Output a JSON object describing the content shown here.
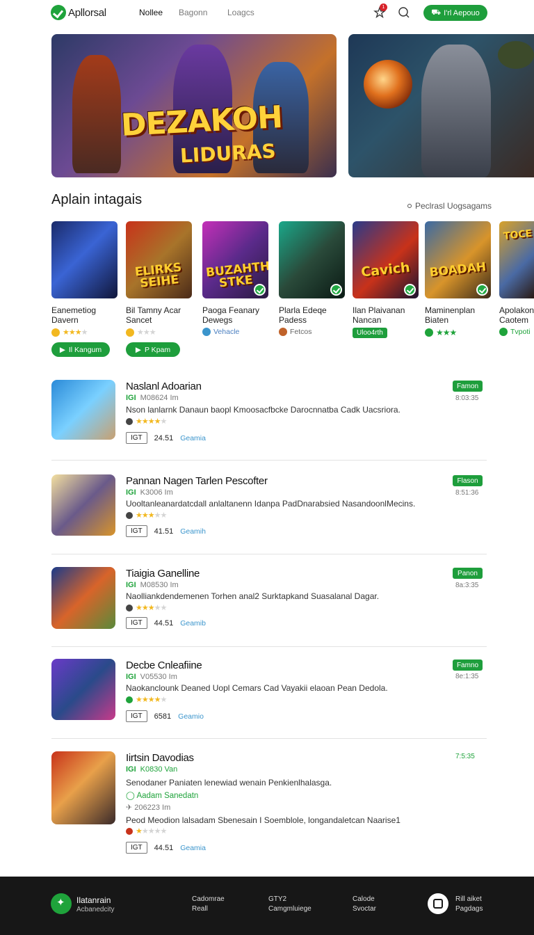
{
  "header": {
    "logo_text": "Apllorsal",
    "nav": [
      "Nollee",
      "Bagonn",
      "Loagcs"
    ],
    "notification_count": "1",
    "cta_label": "I'rl Aepouo"
  },
  "hero": {
    "title_line1": "DEZAKOH",
    "title_line2": "LIDURAS"
  },
  "featured": {
    "section_title": "Aplain intagais",
    "section_link": "Peclrasl Uogsagams",
    "cards": [
      {
        "name_line1": "Eanemetiog",
        "name_line2": "Davern",
        "meta": "",
        "button": "Il Kangum",
        "tile_word": ""
      },
      {
        "name_line1": "Bil Tamny Acar",
        "name_line2": "Sancet",
        "meta": "",
        "button": "P Kpam",
        "tile_word": "ELIRKS SEIHE"
      },
      {
        "name_line1": "Paoga Feanary",
        "name_line2": "Dewegs",
        "meta": "Vehacle",
        "tile_word": "BUZAHTH STKE"
      },
      {
        "name_line1": "Plarla Edeqe",
        "name_line2": "Padess",
        "meta": "Fetcos",
        "tile_word": ""
      },
      {
        "name_line1": "Ilan Plaivanan",
        "name_line2": "Nancan",
        "meta": "Uloo4rth",
        "tile_word": "Cavich"
      },
      {
        "name_line1": "Maminenplan",
        "name_line2": "Biaten",
        "meta": "",
        "tile_word": "BOADAH"
      },
      {
        "name_line1": "Apolakon",
        "name_line2": "Caotem",
        "meta": "Tvpoti",
        "tile_word": "TOCE"
      }
    ]
  },
  "list": [
    {
      "title": "Naslanl Adoarian",
      "sub_code": "IGI",
      "sub_text": "M08624 Im",
      "desc": "Nson lanlarnk Danaun baopl Kmoosacfbcke Darocnnatba Cadk Uacsriora.",
      "box": "IGT",
      "size": "24.51",
      "link": "Geamia",
      "tag": "Famon",
      "date": "8:03:35",
      "rating": 4
    },
    {
      "title": "Pannan Nagen Tarlen Pescofter",
      "sub_code": "IGI",
      "sub_text": "K3006 Im",
      "desc": "Uooltanleanardatcdall anlaltanenn Idanpa PadDnarabsied NasandoonlMecins.",
      "box": "IGT",
      "size": "41.51",
      "link": "Geamih",
      "tag": "Flason",
      "date": "8:51:36",
      "rating": 3
    },
    {
      "title": "Tiaigia Ganelline",
      "sub_code": "IGI",
      "sub_text": "M08530 Im",
      "desc": "Naolliankdendemenen Torhen anal2 Surktapkand Suasalanal Dagar.",
      "box": "IGT",
      "size": "44.51",
      "link": "Geamib",
      "tag": "Panon",
      "date": "8a:3:35",
      "rating": 3
    },
    {
      "title": "Decbe Cnleafiine",
      "sub_code": "IGI",
      "sub_text": "V05530 Im",
      "desc": "Naokanclounk Deaned Uopl Cemars Cad Vayakii elaoan Pean Dedola.",
      "box": "IGT",
      "size": "6581",
      "link": "Geamio",
      "tag": "Famno",
      "date": "8e:1:35",
      "rating": 4
    },
    {
      "title": "Iirtsin Davodias",
      "sub_code": "IGI",
      "sub_text": "K0830 Van",
      "desc": "Senodaner Paniaten lenewiad wenain Penkienlhalasga.",
      "verified": "Aadam Sanedatn",
      "sub_text2": "206223 Im",
      "desc2": "Peod Meodion lalsadam Sbenesain I Soemblole, longandaletcan Naarise1",
      "box": "IGT",
      "size": "44.51",
      "link": "Geamia",
      "tag": "",
      "date": "7:5:35",
      "rating": 1
    }
  ],
  "footer": {
    "brand": "Ilatanrain",
    "brand_sub": "Acbanedcity",
    "col1": [
      "Cadomrae",
      "Reall"
    ],
    "col2": [
      "GTY2",
      "Camgmluiege"
    ],
    "col3": [
      "Calode",
      "Svoctar"
    ],
    "col4": [
      "Rill aiket",
      "Pagdags"
    ]
  },
  "colors": {
    "accent": "#1e9e3c",
    "footer_bg": "#171717",
    "star": "#f2b820",
    "link": "#3b95cc"
  }
}
